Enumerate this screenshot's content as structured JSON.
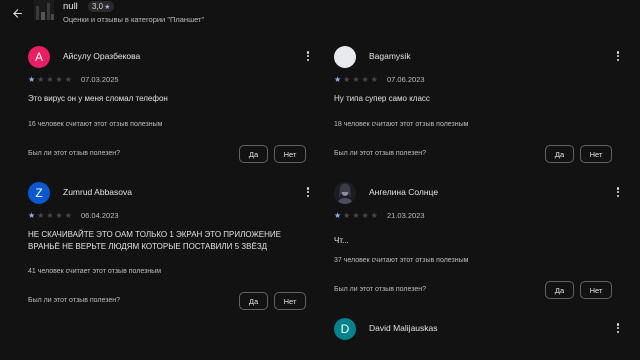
{
  "header": {
    "app_name": "null",
    "rating": "3,0",
    "subtitle": "Оценки и отзывы в категории \"Планшет\""
  },
  "reviews": [
    {
      "name": "Айсулу Оразбекова",
      "initial": "А",
      "avatar_color": "#e91e63",
      "date": "07.03.2025",
      "stars": 1,
      "text": "Это вирус он у меня сломал телефон",
      "helpful": "16 человек считают этот отзыв полезным",
      "question": "Был ли этот отзыв полезен?",
      "yes": "Да",
      "no": "Нет"
    },
    {
      "name": "Bagamysik",
      "initial": "",
      "avatar_color": "#e8eaed",
      "date": "07.06.2023",
      "stars": 1,
      "text": "Ну типа супер само класс",
      "helpful": "18 человек считают этот отзыв полезным",
      "question": "Был ли этот отзыв полезен?",
      "yes": "Да",
      "no": "Нет"
    },
    {
      "name": "Zumrud Abbasova",
      "initial": "Z",
      "avatar_color": "#0b57d0",
      "date": "06.04.2023",
      "stars": 1,
      "text": "НЕ СКАЧИВАЙТЕ ЭТО ОАМ ТОЛЬКО 1 ЭКРАН ЭТО ПРИЛОЖЕНИЕ ВРАНЬЁ НЕ ВЕРЬТЕ ЛЮДЯМ КОТОРЫЕ ПОСТАВИЛИ 5 ЗВЁЗД",
      "helpful": "41 человек считает этот отзыв полезным",
      "question": "Был ли этот отзыв полезен?",
      "yes": "Да",
      "no": "Нет"
    },
    {
      "name": "Ангелина Солнце",
      "initial": "",
      "avatar_color": "#2a2a2e",
      "date": "21.03.2023",
      "stars": 1,
      "text": "Чт...",
      "helpful": "37 человек считают этот отзыв полезным",
      "question": "Был ли этот отзыв полезен?",
      "yes": "Да",
      "no": "Нет"
    },
    {
      "name": "David Malijauskas",
      "initial": "D",
      "avatar_color": "#00838f"
    }
  ]
}
